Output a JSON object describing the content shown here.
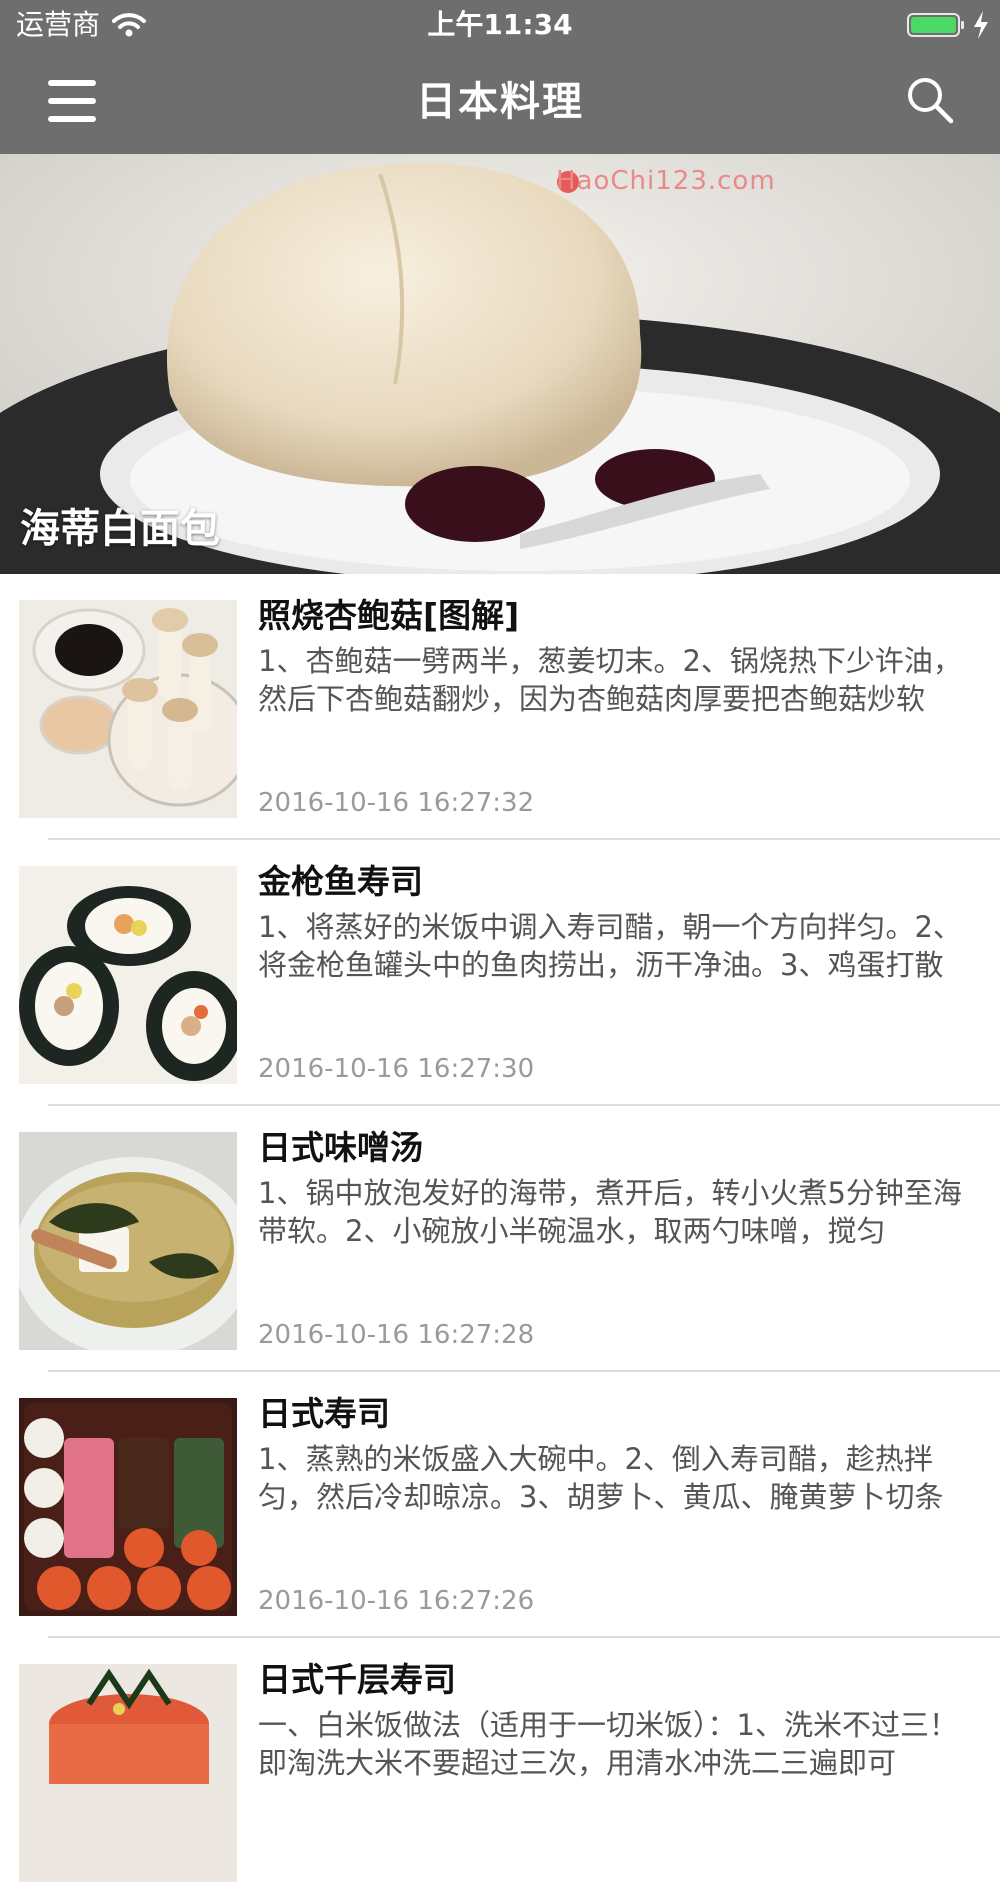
{
  "status_bar": {
    "carrier": "运营商",
    "time": "上午11:34"
  },
  "nav": {
    "title": "日本料理",
    "menu_icon": "hamburger-menu-icon",
    "search_icon": "search-icon"
  },
  "banner": {
    "title": "海蒂白面包",
    "watermark": "HaoChi123.com"
  },
  "list": [
    {
      "title": "照烧杏鲍菇[图解]",
      "desc": "1、杏鲍菇一劈两半，葱姜切末。2、锅烧热下少许油，然后下杏鲍菇翻炒，因为杏鲍菇肉厚要把杏鲍菇炒软",
      "time": "2016-10-16 16:27:32"
    },
    {
      "title": "金枪鱼寿司",
      "desc": "1、将蒸好的米饭中调入寿司醋，朝一个方向拌匀。2、将金枪鱼罐头中的鱼肉捞出，沥干净油。3、鸡蛋打散",
      "time": "2016-10-16 16:27:30"
    },
    {
      "title": "日式味噌汤",
      "desc": "1、锅中放泡发好的海带，煮开后，转小火煮5分钟至海带软。2、小碗放小半碗温水，取两勺味噌，搅匀",
      "time": "2016-10-16 16:27:28"
    },
    {
      "title": "日式寿司",
      "desc": "1、蒸熟的米饭盛入大碗中。2、倒入寿司醋，趁热拌匀，然后冷却晾凉。3、胡萝卜、黄瓜、腌黄萝卜切条",
      "time": "2016-10-16 16:27:26"
    },
    {
      "title": "日式千层寿司",
      "desc": "一、白米饭做法（适用于一切米饭）：1、洗米不过三！即淘洗大米不要超过三次，用清水冲洗二三遍即可",
      "time": ""
    }
  ]
}
